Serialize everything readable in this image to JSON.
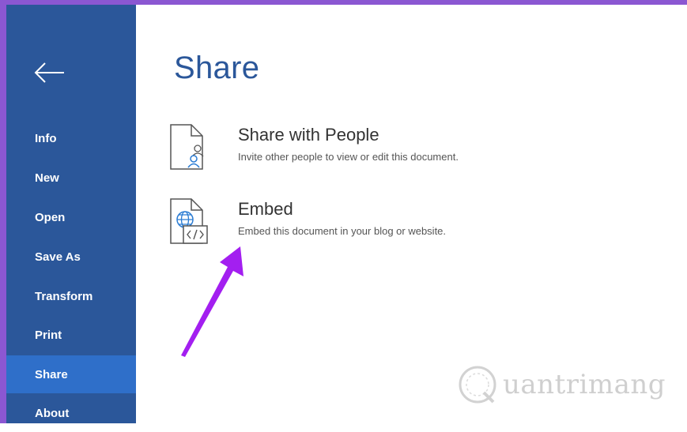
{
  "sidebar": {
    "items": [
      {
        "label": "Info"
      },
      {
        "label": "New"
      },
      {
        "label": "Open"
      },
      {
        "label": "Save As"
      },
      {
        "label": "Transform"
      },
      {
        "label": "Print"
      },
      {
        "label": "Share",
        "active": true
      },
      {
        "label": "About"
      }
    ]
  },
  "main": {
    "title": "Share",
    "options": [
      {
        "title": "Share with People",
        "description": "Invite other people to view or edit this document.",
        "icon": "share-people-icon"
      },
      {
        "title": "Embed",
        "description": "Embed this document in your blog or website.",
        "icon": "embed-icon"
      }
    ]
  },
  "watermark": {
    "text": "uantrimang",
    "logo_letter": "Q"
  },
  "colors": {
    "sidebar": "#2b579a",
    "active": "#2f6fc9",
    "accent": "#8b57d2",
    "arrow": "#a020f0"
  }
}
